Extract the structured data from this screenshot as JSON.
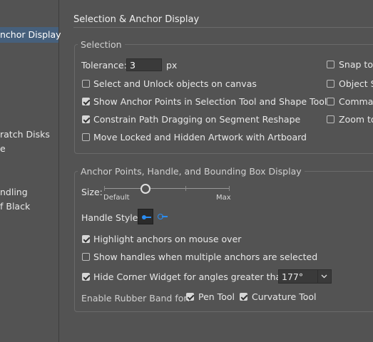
{
  "nav": {
    "items": [
      {
        "label": "nchor Display",
        "selected": true
      },
      {
        "label": "ratch Disks",
        "selected": false
      },
      {
        "label": "e",
        "selected": false
      },
      {
        "label": "ndling",
        "selected": false
      },
      {
        "label": "f Black",
        "selected": false
      }
    ]
  },
  "section_title": "Selection & Anchor Display",
  "selection": {
    "title": "Selection",
    "tolerance_label": "Tolerance:",
    "tolerance_value": "3",
    "tolerance_unit": "px",
    "options": [
      {
        "label": "Select and Unlock objects on canvas",
        "checked": false
      },
      {
        "label": "Show Anchor Points in Selection Tool and Shape Tools",
        "checked": true
      },
      {
        "label": "Constrain Path Dragging on Segment Reshape",
        "checked": true
      },
      {
        "label": "Move Locked and Hidden Artwork with Artboard",
        "checked": false
      }
    ],
    "right_options": [
      {
        "label": "Snap to",
        "checked": false
      },
      {
        "label": "Object S",
        "checked": false
      },
      {
        "label": "Comma",
        "checked": false
      },
      {
        "label": "Zoom to",
        "checked": false
      }
    ]
  },
  "anchor": {
    "title": "Anchor Points, Handle, and Bounding Box Display",
    "size_label": "Size:",
    "size_min_label": "Default",
    "size_max_label": "Max",
    "size_level": 0.33,
    "handle_style_label": "Handle Style:",
    "options": [
      {
        "label": "Highlight anchors on mouse over",
        "checked": true
      },
      {
        "label": "Show handles when multiple anchors are selected",
        "checked": false
      },
      {
        "label": "Hide Corner Widget for angles greater than:",
        "checked": true
      }
    ],
    "corner_angle_value": "177°",
    "rubber_band_label": "Enable Rubber Band for:",
    "rubber_band": [
      {
        "label": "Pen Tool",
        "checked": true
      },
      {
        "label": "Curvature Tool",
        "checked": true
      }
    ]
  }
}
